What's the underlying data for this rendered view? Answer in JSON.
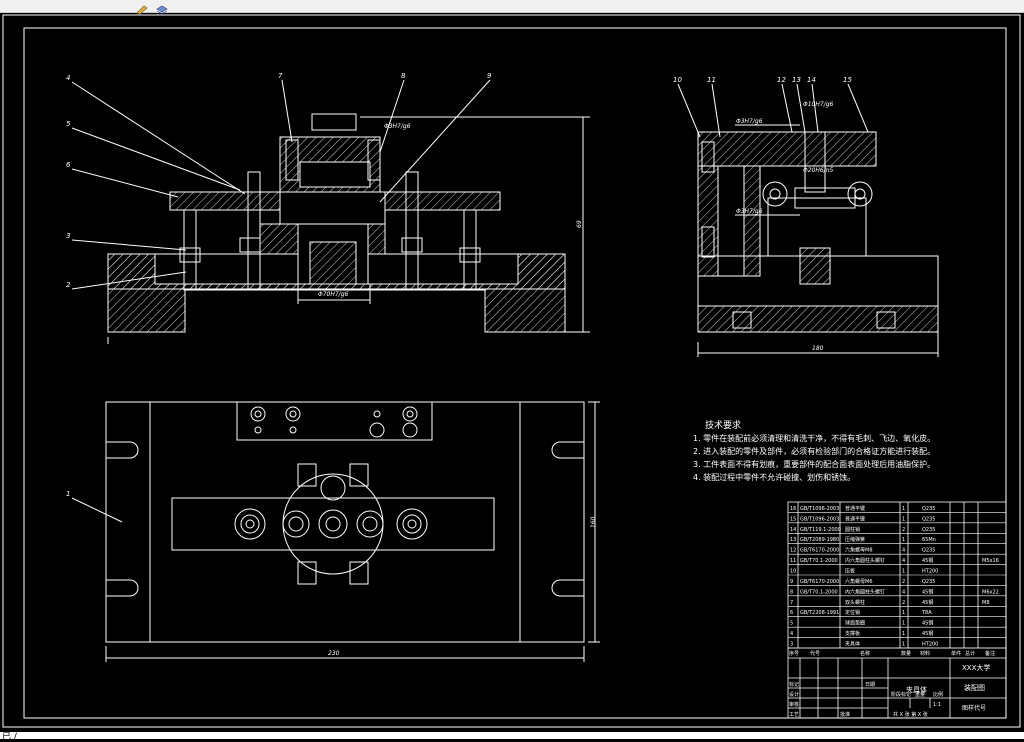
{
  "toolbar": {
    "buttons": [
      "edit-icon",
      "layers-icon"
    ]
  },
  "status": {
    "text": "已 /"
  },
  "front_view": {
    "callouts": [
      "4",
      "5",
      "6",
      "7",
      "8",
      "9",
      "3",
      "2"
    ],
    "fit_top": "Φ3H7/g6",
    "fit_bottom": "Φ70H7/g6",
    "dim_height": "69"
  },
  "side_view": {
    "callouts": [
      "10",
      "11",
      "12",
      "13",
      "14",
      "15"
    ],
    "fit_1": "Φ3H7/g6",
    "fit_2": "Φ10H7/g6",
    "fit_3": "Φ20H6/n5",
    "fit_4": "Φ3H7/g6",
    "dim_width": "180"
  },
  "top_view": {
    "callout": "1",
    "dim_width": "230",
    "dim_height": "160"
  },
  "tech_req": {
    "title": "技术要求",
    "lines": [
      "1. 零件在装配前必须清理和清洗干净，不得有毛刺、飞边、氧化皮。",
      "2. 进入装配的零件及部件，必须有检验部门的合格证方能进行装配。",
      "3. 工件表面不得有划痕，重要部件的配合面表面处理后用油脂保护。",
      "4. 装配过程中零件不允许碰撞、划伤和锈蚀。"
    ]
  },
  "bom": {
    "rows": [
      {
        "no": "16",
        "code": "GB/T1096-2003",
        "name": "普通平键",
        "qty": "1",
        "mat": "Q235",
        "note": ""
      },
      {
        "no": "15",
        "code": "GB/T1096-2003",
        "name": "普通平键",
        "qty": "1",
        "mat": "Q235",
        "note": ""
      },
      {
        "no": "14",
        "code": "GB/T119.1-2000",
        "name": "圆柱销",
        "qty": "2",
        "mat": "Q235",
        "note": ""
      },
      {
        "no": "13",
        "code": "GB/T2089-1980",
        "name": "压缩弹簧",
        "qty": "1",
        "mat": "65Mn",
        "note": ""
      },
      {
        "no": "12",
        "code": "GB/T6170-2000",
        "name": "六角螺母M8",
        "qty": "4",
        "mat": "Q235",
        "note": ""
      },
      {
        "no": "11",
        "code": "GB/T70.1-2000",
        "name": "内六角圆柱头螺钉",
        "qty": "4",
        "mat": "45钢",
        "note": "M5x16"
      },
      {
        "no": "10",
        "code": "",
        "name": "压板",
        "qty": "1",
        "mat": "HT200",
        "note": ""
      },
      {
        "no": "9",
        "code": "GB/T6170-2000",
        "name": "六角螺母M6",
        "qty": "2",
        "mat": "Q235",
        "note": ""
      },
      {
        "no": "8",
        "code": "GB/T70.1-2000",
        "name": "内六角圆柱头螺钉",
        "qty": "4",
        "mat": "45钢",
        "note": "M6x22"
      },
      {
        "no": "7",
        "code": "",
        "name": "双头螺柱",
        "qty": "2",
        "mat": "45钢",
        "note": "M8"
      },
      {
        "no": "6",
        "code": "GB/T2208-1991",
        "name": "定位销",
        "qty": "1",
        "mat": "T8A",
        "note": ""
      },
      {
        "no": "5",
        "code": "",
        "name": "球面垫圈",
        "qty": "1",
        "mat": "45钢",
        "note": ""
      },
      {
        "no": "4",
        "code": "",
        "name": "支撑板",
        "qty": "1",
        "mat": "45钢",
        "note": ""
      },
      {
        "no": "3",
        "code": "",
        "name": "夹具体",
        "qty": "1",
        "mat": "HT200",
        "note": ""
      }
    ],
    "header": [
      "序号",
      "代号",
      "名称",
      "数量",
      "材料",
      "单件",
      "总计",
      "备注"
    ],
    "school": "XXX大学",
    "drawing_name": "夹具体",
    "assembly": "装配图",
    "drawing_no": "图样代号",
    "scale": "1:1",
    "sheet": "共 X 张  第 X 张",
    "labels": {
      "marks": "标记",
      "design": "设计",
      "review": "审核",
      "process": "工艺",
      "approve": "批准",
      "stage": "阶段标记",
      "weight": "重量",
      "ratio": "比例",
      "date": "日期"
    }
  },
  "colors": {
    "background": "#000000",
    "lines": "#ffffff",
    "hatch": "#ffffff"
  }
}
